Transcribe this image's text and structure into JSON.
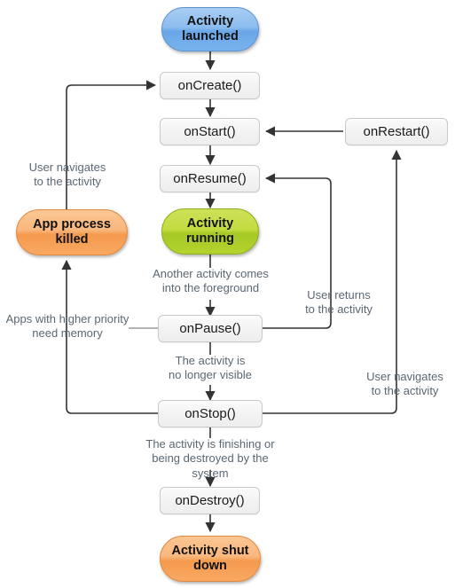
{
  "diagram": {
    "title": "Android Activity Lifecycle",
    "background_color": "#ffffff",
    "edge_color": "#333333",
    "edge_label_color": "#5a6773",
    "accent_colors": {
      "state_launched": "#8cbdef",
      "state_running": "#c3dc3f",
      "state_killed": "#f9b77d",
      "state_shutdown": "#f9b77d",
      "method_box": "#f2f2f2"
    }
  },
  "nodes": {
    "activity_launched": {
      "label": "Activity\nlaunched",
      "type": "state",
      "color": "#8cbdef"
    },
    "on_create": {
      "label": "onCreate()",
      "type": "method"
    },
    "on_start": {
      "label": "onStart()",
      "type": "method"
    },
    "on_resume": {
      "label": "onResume()",
      "type": "method"
    },
    "activity_running": {
      "label": "Activity\nrunning",
      "type": "state",
      "color": "#c3dc3f"
    },
    "on_pause": {
      "label": "onPause()",
      "type": "method"
    },
    "on_stop": {
      "label": "onStop()",
      "type": "method"
    },
    "on_destroy": {
      "label": "onDestroy()",
      "type": "method"
    },
    "on_restart": {
      "label": "onRestart()",
      "type": "method"
    },
    "app_process_killed": {
      "label": "App process\nkilled",
      "type": "state",
      "color": "#f9b77d"
    },
    "activity_shut_down": {
      "label": "Activity\nshut down",
      "type": "state",
      "color": "#f9b77d"
    }
  },
  "edge_labels": {
    "user_navigates_left": "User navigates\nto the activity",
    "another_activity": "Another activity comes\ninto the foreground",
    "apps_higher_priority": "Apps with higher priority\nneed memory",
    "no_longer_visible": "The activity is\nno longer visible",
    "user_returns": "User returns\nto the activity",
    "user_navigates_right": "User navigates\nto the activity",
    "finishing_or_destroyed": "The activity is finishing or\nbeing destroyed by the system"
  }
}
